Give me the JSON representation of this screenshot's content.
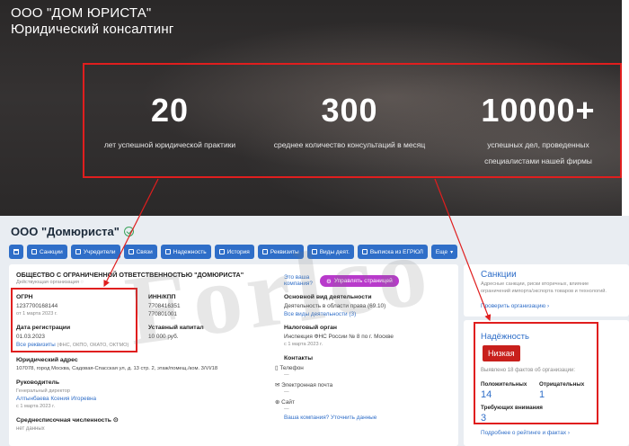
{
  "hero": {
    "title_line1": "ООО \"ДОМ ЮРИСТА\"",
    "title_line2": "Юридический консалтинг",
    "stats": [
      {
        "number": "20",
        "caption_line1": "лет успешной юридической практики",
        "caption_line2": ""
      },
      {
        "number": "300",
        "caption_line1": "среднее количество консультаций в месяц",
        "caption_line2": ""
      },
      {
        "number": "10000+",
        "caption_line1": "успешных дел, проведенных",
        "caption_line2": "специалистами нашей фирмы"
      }
    ]
  },
  "org": {
    "name": "ООО \"Домюриста\"",
    "full_name": "ОБЩЕСТВО С ОГРАНИЧЕННОЙ ОТВЕТСТВЕННОСТЬЮ \"ДОМЮРИСТА\"",
    "status": "Действующая организация"
  },
  "toolbar": {
    "buttons": [
      "Санкции",
      "Учредители",
      "Связи",
      "Надежность",
      "История",
      "Реквизиты",
      "Виды деят.",
      "Выписка из ЕГРЮЛ",
      "Еще"
    ]
  },
  "left": {
    "ogrn_label": "ОГРН",
    "ogrn_value": "1237700168144",
    "ogrn_date": "от 1 марта 2023 г.",
    "reg_label": "Дата регистрации",
    "reg_value": "01.03.2023",
    "all_req_link": "Все реквизиты",
    "all_req_hint": "(ФНС, ОКПО, ОКАТО, ОКТМО)",
    "address_label": "Юридический адрес",
    "address_value": "107078, город Москва, Садовая-Спасская ул, д. 13 стр. 2, этаж/помещ./ком. 3/VI/18",
    "head_label": "Руководитель",
    "head_role": "Генеральный директор",
    "head_name": "Алтынбаева Ксения Игоревна",
    "head_date": "с 1 марта 2023 г.",
    "staff_label": "Среднесписочная численность",
    "staff_value": "нет данных"
  },
  "middle": {
    "inn_label": "ИНН/КПП",
    "inn_value": "7708416351",
    "kpp_value": "770801001",
    "capital_label": "Уставный капитал",
    "capital_value": "10 000 руб."
  },
  "third": {
    "own_q_line1": "Это ваша",
    "own_q_line2": "компания?",
    "manage_btn": "Управлять страницей",
    "activity_label": "Основной вид деятельности",
    "activity_value": "Деятельность в области права (69.10)",
    "activity_link": "Все виды деятельности (3)",
    "tax_label": "Налоговый орган",
    "tax_value": "Инспекция ФНС России № 8 по г. Москве",
    "tax_date": "с 1 марта 2023 г.",
    "contacts_label": "Контакты",
    "phone_label": "Телефон",
    "phone_value": "—",
    "email_label": "Электронная почта",
    "email_value": "—",
    "site_label": "Сайт",
    "site_value": "—",
    "clarify_link": "Ваша компания? Уточнить данные"
  },
  "sanctions": {
    "title": "Санкции",
    "text_line1": "Адресные санкции, риски вторичных, влияние",
    "text_line2": "ограничений импорта/экспорта товаров и технологий.",
    "link": "Проверить организацию"
  },
  "reliability": {
    "title": "Надёжность",
    "level": "Низкая",
    "facts": "Выявлено 18 фактов об организации:",
    "positive_label": "Положительных",
    "positive_value": "14",
    "negative_label": "Отрицательных",
    "negative_value": "1",
    "attention_label": "Требующих внимания",
    "attention_value": "3",
    "link": "Подробнее о рейтинге и фактах"
  },
  "watermark": "Forlco",
  "colors": {
    "accent": "#2f6ec8",
    "annotation": "#e01e1e",
    "low_badge": "#c8201c",
    "manage": "#b83acb"
  }
}
